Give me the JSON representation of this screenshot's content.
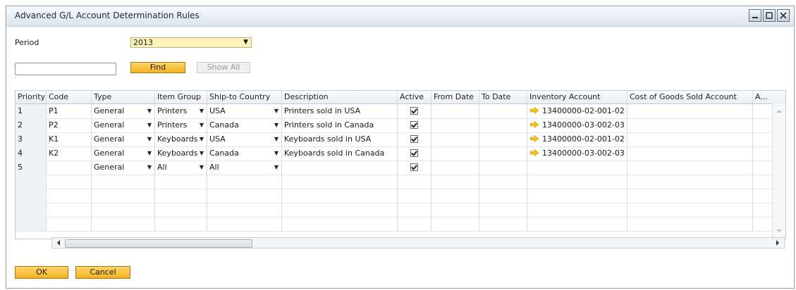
{
  "window": {
    "title": "Advanced G/L Account Determination Rules"
  },
  "filters": {
    "period_label": "Period",
    "period_value": "2013",
    "search_value": "",
    "find_label": "Find",
    "show_all_label": "Show All"
  },
  "table": {
    "columns": [
      "Priority",
      "Code",
      "Type",
      "Item Group",
      "Ship-to Country",
      "Description",
      "Active",
      "From Date",
      "To Date",
      "Inventory Account",
      "Cost of Goods Sold Account",
      "A..."
    ],
    "rows": [
      {
        "priority": "1",
        "code": "P1",
        "type": "General",
        "item_group": "Printers",
        "country": "USA",
        "description": "Printers sold in USA",
        "active": true,
        "from": "",
        "to": "",
        "inventory_account": "13400000-02-001-02"
      },
      {
        "priority": "2",
        "code": "P2",
        "type": "General",
        "item_group": "Printers",
        "country": "Canada",
        "description": "Printers sold in Canada",
        "active": true,
        "from": "",
        "to": "",
        "inventory_account": "13400000-03-002-03"
      },
      {
        "priority": "3",
        "code": "K1",
        "type": "General",
        "item_group": "Keyboards",
        "country": "USA",
        "description": "Keyboards sold in USA",
        "active": true,
        "from": "",
        "to": "",
        "inventory_account": "13400000-02-001-02"
      },
      {
        "priority": "4",
        "code": "K2",
        "type": "General",
        "item_group": "Keyboards",
        "country": "Canada",
        "description": "Keyboards sold in Canada",
        "active": true,
        "from": "",
        "to": "",
        "inventory_account": "13400000-03-002-03"
      },
      {
        "priority": "5",
        "code": "",
        "type": "General",
        "item_group": "All",
        "country": "All",
        "description": "",
        "active": true,
        "from": "",
        "to": "",
        "inventory_account": ""
      }
    ]
  },
  "footer": {
    "ok_label": "OK",
    "cancel_label": "Cancel"
  },
  "colors": {
    "accent_button": "#f3b222",
    "highlight_field": "#fdf2b8",
    "link_arrow": "#f2c21b"
  },
  "icons": {
    "minimize": "minimize-icon",
    "maximize": "maximize-icon",
    "close": "close-icon",
    "dropdown": "chevron-down-icon",
    "link": "link-arrow-icon",
    "check": "checkbox-checked-icon"
  }
}
